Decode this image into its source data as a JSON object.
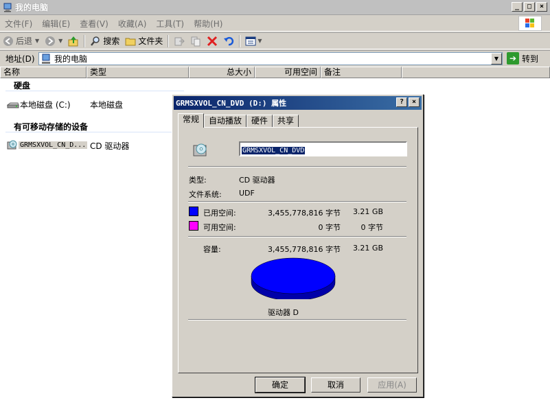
{
  "window": {
    "title": "我的电脑"
  },
  "menu": [
    "文件(F)",
    "编辑(E)",
    "查看(V)",
    "收藏(A)",
    "工具(T)",
    "帮助(H)"
  ],
  "toolbar": {
    "back": "后退",
    "search": "搜索",
    "folders": "文件夹"
  },
  "address": {
    "label": "地址(D)",
    "value": "我的电脑",
    "go": "转到"
  },
  "columns": [
    "名称",
    "类型",
    "总大小",
    "可用空间",
    "备注"
  ],
  "groups": {
    "hard_disks": "硬盘",
    "removable": "有可移动存储的设备"
  },
  "items": [
    {
      "name": "本地磁盘 (C:)",
      "type": "本地磁盘"
    },
    {
      "name": "GRMSXVOL_CN_D...",
      "type": "CD 驱动器"
    }
  ],
  "dialog": {
    "title": "GRMSXVOL_CN_DVD (D:) 属性",
    "tabs": [
      "常规",
      "自动播放",
      "硬件",
      "共享"
    ],
    "volume_label": "GRMSXVOL_CN_DVD",
    "type_label": "类型:",
    "type_value": "CD 驱动器",
    "fs_label": "文件系统:",
    "fs_value": "UDF",
    "used_label": "已用空间:",
    "used_bytes": "3,455,778,816 字节",
    "used_size": "3.21 GB",
    "free_label": "可用空间:",
    "free_bytes": "0 字节",
    "free_size": "0 字节",
    "capacity_label": "容量:",
    "capacity_bytes": "3,455,778,816 字节",
    "capacity_size": "3.21 GB",
    "drive_label": "驱动器 D",
    "used_color": "#0000ff",
    "free_color": "#ff00ff",
    "ok": "确定",
    "cancel": "取消",
    "apply": "应用(A)"
  }
}
